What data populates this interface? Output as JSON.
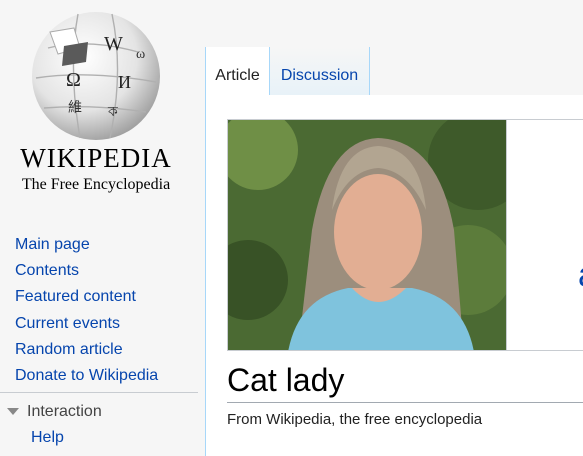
{
  "logo": {
    "wordmark": "WIKIPEDIA",
    "tagline": "The Free Encyclopedia"
  },
  "sidebar": {
    "items": [
      {
        "label": "Main page"
      },
      {
        "label": "Contents"
      },
      {
        "label": "Featured content"
      },
      {
        "label": "Current events"
      },
      {
        "label": "Random article"
      },
      {
        "label": "Donate to Wikipedia"
      }
    ],
    "interaction": {
      "heading": "Interaction",
      "items": [
        {
          "label": "Help"
        }
      ]
    }
  },
  "tabs": [
    {
      "label": "Article",
      "active": true
    },
    {
      "label": "Discussion",
      "active": false
    }
  ],
  "article": {
    "title": "Cat lady",
    "tagline": "From Wikipedia, the free encyclopedia",
    "partial_text": "a"
  },
  "colors": {
    "link": "#0645ad",
    "tab_border": "#a7d7f9",
    "sidebar_bg": "#f6f6f6"
  }
}
